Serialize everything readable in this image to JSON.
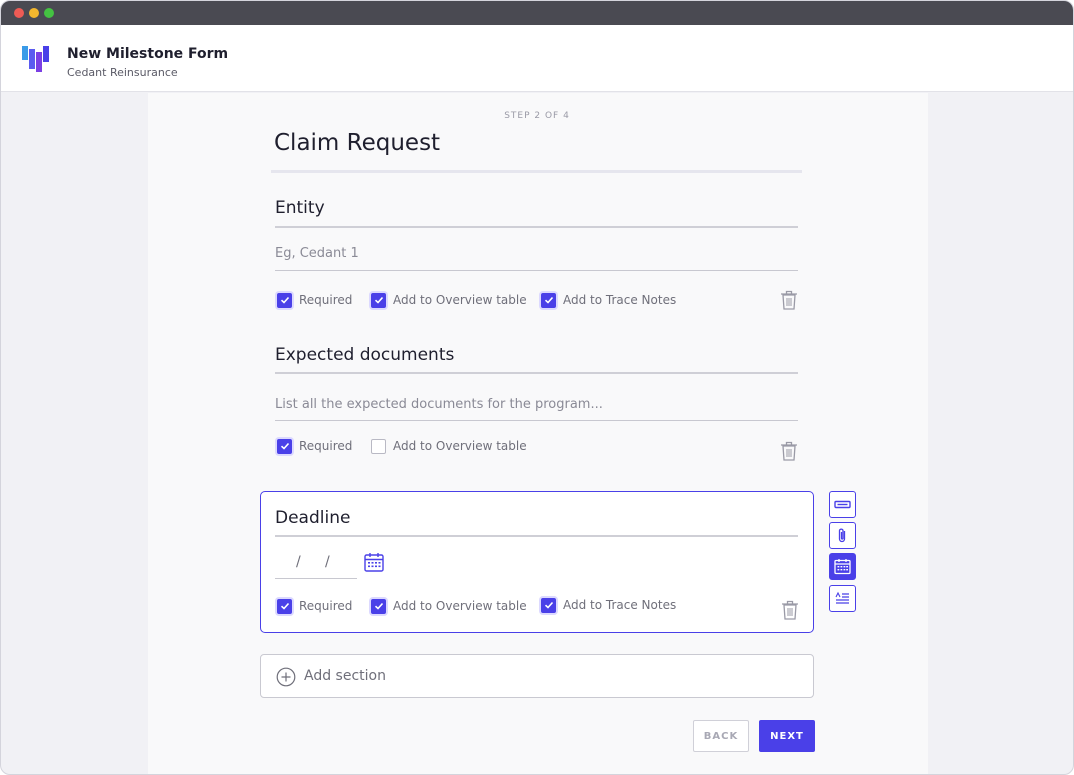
{
  "window": {
    "controls": [
      "close",
      "minimize",
      "maximize"
    ]
  },
  "header": {
    "logo_icon": "milestone-logo-icon",
    "title": "New Milestone Form",
    "subtitle": "Cedant Reinsurance"
  },
  "form": {
    "step": "STEP 2 OF 4",
    "title": "Claim Request",
    "sections": [
      {
        "label": "Entity",
        "placeholder": "Eg, Cedant 1",
        "options": [
          {
            "label": "Required",
            "checked": true
          },
          {
            "label": "Add to Overview table",
            "checked": true
          },
          {
            "label": "Add to Trace Notes",
            "checked": true
          }
        ]
      },
      {
        "label": "Expected documents",
        "placeholder": "List all the expected documents for the program...",
        "options": [
          {
            "label": "Required",
            "checked": true
          },
          {
            "label": "Add to Overview table",
            "checked": false
          }
        ]
      },
      {
        "label": "Deadline",
        "date_separators": [
          "/",
          "/"
        ],
        "options": [
          {
            "label": "Required",
            "checked": true
          },
          {
            "label": "Add to Overview table",
            "checked": true
          },
          {
            "label": "Add to Trace Notes",
            "checked": true
          }
        ]
      }
    ],
    "field_type_tools": [
      {
        "icon": "text-field-icon",
        "active": false
      },
      {
        "icon": "attachment-icon",
        "active": false
      },
      {
        "icon": "calendar-icon",
        "active": true
      },
      {
        "icon": "paragraph-icon",
        "active": false
      }
    ],
    "add_section_label": "Add section",
    "back_label": "BACK",
    "next_label": "NEXT"
  },
  "colors": {
    "accent": "#4a40e8",
    "titlebar": "#4a4a52"
  }
}
